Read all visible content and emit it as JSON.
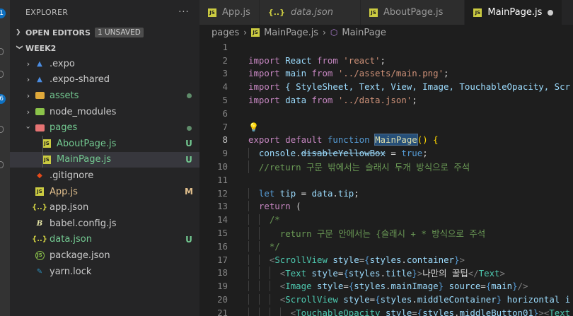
{
  "activity": {
    "badges": [
      "1",
      "6"
    ]
  },
  "explorer": {
    "title": "EXPLORER",
    "more": "···",
    "open_editors": {
      "label": "OPEN EDITORS",
      "badge": "1 UNSAVED"
    },
    "workspace": "WEEK2",
    "items": [
      {
        "label": ".expo",
        "icon": "expo-icon",
        "status": ""
      },
      {
        "label": ".expo-shared",
        "icon": "expo-icon",
        "status": ""
      },
      {
        "label": "assets",
        "icon": "folder-icon",
        "status": "dot"
      },
      {
        "label": "node_modules",
        "icon": "folder-icon",
        "status": ""
      },
      {
        "label": "pages",
        "icon": "folder-open-icon",
        "status": "dot"
      },
      {
        "label": "AboutPage.js",
        "icon": "js-icon",
        "status": "U"
      },
      {
        "label": "MainPage.js",
        "icon": "js-icon",
        "status": "U"
      },
      {
        "label": ".gitignore",
        "icon": "git-icon",
        "status": ""
      },
      {
        "label": "App.js",
        "icon": "js-icon",
        "status": "M"
      },
      {
        "label": "app.json",
        "icon": "json-icon",
        "status": ""
      },
      {
        "label": "babel.config.js",
        "icon": "babel-icon",
        "status": ""
      },
      {
        "label": "data.json",
        "icon": "json-icon",
        "status": "U"
      },
      {
        "label": "package.json",
        "icon": "npm-icon",
        "status": ""
      },
      {
        "label": "yarn.lock",
        "icon": "yarn-icon",
        "status": ""
      }
    ]
  },
  "tabs": [
    {
      "label": "App.js",
      "icon": "js-icon",
      "active": false
    },
    {
      "label": "data.json",
      "icon": "json-icon",
      "active": false
    },
    {
      "label": "AboutPage.js",
      "icon": "js-icon",
      "active": false
    },
    {
      "label": "MainPage.js",
      "icon": "js-icon",
      "active": true
    }
  ],
  "breadcrumb": {
    "folder": "pages",
    "file": "MainPage.js",
    "symbol": "MainPage"
  },
  "colors": {
    "accent": "#0e70c0",
    "untracked": "#73c991",
    "modified": "#e2c08d",
    "selection": "#264f78"
  },
  "code": {
    "line_numbers": [
      "1",
      "2",
      "3",
      "4",
      "5",
      "6",
      "7",
      "8",
      "9",
      "10",
      "11",
      "12",
      "13",
      "14",
      "15",
      "16",
      "17",
      "18",
      "19",
      "20",
      "21"
    ],
    "l2": [
      "import",
      " React ",
      "from",
      " 'react'",
      ";"
    ],
    "l3": [
      "import",
      " main ",
      "from",
      " '../assets/main.png'",
      ";"
    ],
    "l4": [
      "import",
      " { StyleSheet, Text, View, Image, TouchableOpacity, Scr"
    ],
    "l5": [
      "import",
      " data ",
      "from",
      " '../data.json'",
      ";"
    ],
    "l8": [
      "export",
      " ",
      "default",
      " ",
      "function",
      " ",
      "MainPage",
      "() {"
    ],
    "l9": [
      "console",
      ".",
      "disableYellowBox",
      " = ",
      "true",
      ";"
    ],
    "l10": "//return 구문 밖에서는 슬래시 두개 방식으로 주석",
    "l12": [
      "let",
      " ",
      "tip",
      " = ",
      "data",
      ".",
      "tip",
      ";"
    ],
    "l13": [
      "return",
      " ("
    ],
    "l14": "/*",
    "l15": "return 구문 안에서는 {슬래시 + * 방식으로 주석",
    "l16": "*/",
    "l17": [
      "<",
      "ScrollView",
      " ",
      "style",
      "=",
      "{",
      "styles",
      ".",
      "container",
      "}",
      ">"
    ],
    "l18": [
      "<",
      "Text",
      " ",
      "style",
      "=",
      "{",
      "styles",
      ".",
      "title",
      "}",
      ">",
      "나만의 꿀팁",
      "</",
      "Text",
      ">"
    ],
    "l19": [
      "<",
      "Image",
      " ",
      "style",
      "=",
      "{",
      "styles",
      ".",
      "mainImage",
      "}",
      " ",
      "source",
      "=",
      "{",
      "main",
      "}",
      "/>"
    ],
    "l20": [
      "<",
      "ScrollView",
      " ",
      "style",
      "=",
      "{",
      "styles",
      ".",
      "middleContainer",
      "}",
      " ",
      "horizontal",
      " i"
    ],
    "l21": [
      "<",
      "TouchableOpacity",
      " ",
      "style",
      "=",
      "{",
      "styles",
      ".",
      "middleButton01",
      "}",
      "><",
      "Text"
    ]
  }
}
